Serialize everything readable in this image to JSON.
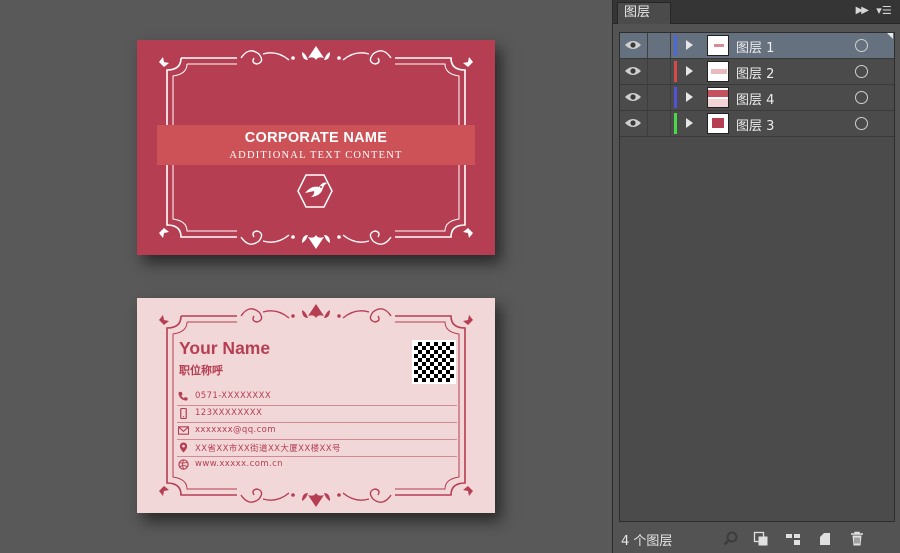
{
  "canvas": {
    "front_card": {
      "title": "CORPORATE NAME",
      "subtitle": "ADDITIONAL TEXT CONTENT",
      "logo_icon": "bird-hexagon-logo-icon"
    },
    "back_card": {
      "name": "Your Name",
      "job_title": "职位称呼",
      "qr_icon": "qr-code-icon",
      "contacts": [
        {
          "icon": "phone-icon",
          "text": "0571-XXXXXXXX"
        },
        {
          "icon": "mobile-icon",
          "text": "123XXXXXXXX"
        },
        {
          "icon": "email-icon",
          "text": "xxxxxxx@qq.com"
        },
        {
          "icon": "location-pin-icon",
          "text": "XX省XX市XX街道XX大厦XX楼XX号"
        },
        {
          "icon": "globe-icon",
          "text": "www.xxxxx.com.cn"
        }
      ]
    },
    "colors": {
      "front_bg": "#b53e52",
      "front_band": "#cd5257",
      "back_bg": "#f2d7d8",
      "accent": "#b53e52"
    }
  },
  "layers_panel": {
    "tab_label": "图层",
    "fast_forward_icon": "double-chevron-icon",
    "menu_icon": "panel-menu-icon",
    "layers": [
      {
        "name": "图层 1",
        "color": "#4a68d6",
        "selected": true
      },
      {
        "name": "图层 2",
        "color": "#d84848",
        "selected": false
      },
      {
        "name": "图层 4",
        "color": "#5252d8",
        "selected": false
      },
      {
        "name": "图层 3",
        "color": "#48d848",
        "selected": false
      }
    ],
    "footer": {
      "count_label": "4 个图层",
      "icons": [
        "search-icon",
        "clipping-mask-icon",
        "new-sublayer-icon",
        "new-layer-icon",
        "trash-icon"
      ]
    }
  }
}
